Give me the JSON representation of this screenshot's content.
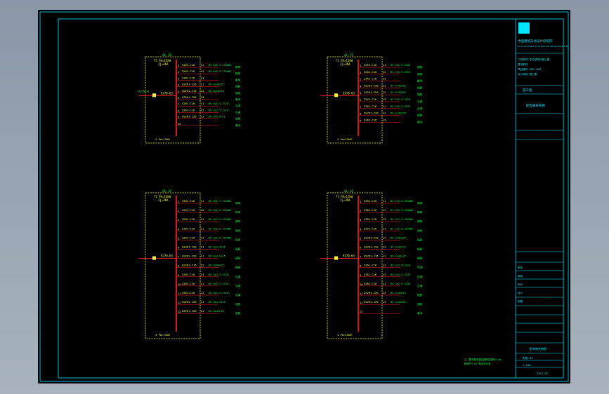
{
  "panels": [
    {
      "id": "AL-1F",
      "incoming": {
        "breaker": "T1 PA=15kW",
        "note": "Ij=36A",
        "cable_tag": "YJV-5x10",
        "device": "E270-63"
      },
      "bottom_note": "4 Pa=15kW",
      "rows": [
        {
          "n": "1",
          "breaker": "S261-C16",
          "phase": "L1",
          "cable": "BV-3x2.5-SC20WC",
          "load": "照明"
        },
        {
          "n": "2",
          "breaker": "S261-C16",
          "phase": "L2",
          "cable": "BV-3x2.5-SC20WC",
          "load": "照明"
        },
        {
          "n": "3",
          "breaker": "S261-C16",
          "phase": "L3",
          "cable": "",
          "load": "备用"
        },
        {
          "n": "4",
          "breaker": "GS261-C20",
          "phase": "L1",
          "cable": "BV-3x4SC25",
          "load": "插座"
        },
        {
          "n": "5",
          "breaker": "GS261-C16",
          "phase": "L2",
          "cable": "BV-3x4SC25",
          "load": "插座"
        },
        {
          "n": "6",
          "breaker": "GS261-C20",
          "phase": "L3",
          "cable": "",
          "load": "备用"
        },
        {
          "n": "7",
          "breaker": "S261-C16",
          "phase": "L1",
          "cable": "BV-3x2.5-SC20",
          "load": "空调"
        },
        {
          "n": "8",
          "breaker": "S261-C16",
          "phase": "L2",
          "cable": "BV-3x2.5-SC20",
          "load": "空调"
        },
        {
          "n": "9",
          "breaker": "GS261-C20",
          "phase": "L3",
          "cable": "BV-3x4-SC25",
          "load": "插座"
        },
        {
          "n": "10",
          "breaker": "",
          "phase": "",
          "cable": "",
          "load": "备用"
        }
      ]
    },
    {
      "id": "AL-2F",
      "incoming": {
        "breaker": "T1 PA=15kW",
        "note": "Ij=36A",
        "cable_tag": "",
        "device": "E270-63"
      },
      "bottom_note": "4 Pa=15kW",
      "rows": [
        {
          "n": "1",
          "breaker": "S261-C16",
          "phase": "L1",
          "cable": "BV-3x2.5-SC20",
          "load": "照明"
        },
        {
          "n": "2",
          "breaker": "S261-C16",
          "phase": "L2",
          "cable": "BV-3x2.5-SC20",
          "load": "照明"
        },
        {
          "n": "3",
          "breaker": "S261-C16",
          "phase": "L3",
          "cable": "",
          "load": "备用"
        },
        {
          "n": "4",
          "breaker": "GS261-C20",
          "phase": "L1",
          "cable": "BV-3x4SC25",
          "load": "插座"
        },
        {
          "n": "5",
          "breaker": "GS261-C20",
          "phase": "L2",
          "cable": "BV-3x4SC25",
          "load": "插座"
        },
        {
          "n": "6",
          "breaker": "S261-C16",
          "phase": "L3",
          "cable": "BV-3x2.5-SC20",
          "load": "空调"
        },
        {
          "n": "7",
          "breaker": "S261-C16",
          "phase": "L1",
          "cable": "BV-3x2.5-SC20",
          "load": "空调"
        },
        {
          "n": "8",
          "breaker": "GS261-C20",
          "phase": "L2",
          "cable": "BV-3x4SC25",
          "load": "插座"
        },
        {
          "n": "9",
          "breaker": "S261-C16",
          "phase": "L3",
          "cable": "",
          "load": "备用"
        }
      ]
    },
    {
      "id": "AL-3F",
      "incoming": {
        "breaker": "T1 PA=15kW",
        "note": "Ij=36A",
        "cable_tag": "",
        "device": "E270-63"
      },
      "bottom_note": "4 Pa=15kW",
      "rows": [
        {
          "n": "1",
          "breaker": "S261-C16",
          "phase": "L1",
          "cable": "BV-3x2.5-SC20WC",
          "load": "照明"
        },
        {
          "n": "2",
          "breaker": "S261-C16",
          "phase": "L2",
          "cable": "BV-3x2.5-SC20WC",
          "load": "照明"
        },
        {
          "n": "3",
          "breaker": "S261-C16",
          "phase": "L3",
          "cable": "BV-3x2.5-SC20WC",
          "load": "照明"
        },
        {
          "n": "4",
          "breaker": "S261-C16",
          "phase": "L1",
          "cable": "BV-3x2.5-SC20WC",
          "load": "照明"
        },
        {
          "n": "5",
          "breaker": "S261-C16",
          "phase": "L2",
          "cable": "BV-3x2.5-SC20WC",
          "load": "照明"
        },
        {
          "n": "6",
          "breaker": "GS261-C20",
          "phase": "L3",
          "cable": "BV-3x4-SC25",
          "load": "插座"
        },
        {
          "n": "7",
          "breaker": "GS261-C20",
          "phase": "L1",
          "cable": "BV-3x4-SC25",
          "load": "插座"
        },
        {
          "n": "8",
          "breaker": "GS261-C16",
          "phase": "L2",
          "cable": "BV-3x4SC25",
          "load": "插座"
        },
        {
          "n": "9",
          "breaker": "S261-C16",
          "phase": "L3",
          "cable": "BV-3x2.5-SC20",
          "load": "空调"
        },
        {
          "n": "10",
          "breaker": "S261-C16",
          "phase": "L1",
          "cable": "BV-3x2.5-SC20",
          "load": "空调"
        },
        {
          "n": "11",
          "breaker": "S261-C16",
          "phase": "L2",
          "cable": "BV-3x2.5-SC20",
          "load": "空调"
        },
        {
          "n": "12",
          "breaker": "GS261-C20",
          "phase": "L3",
          "cable": "BV-3x4-SC25",
          "load": "插座"
        },
        {
          "n": "13",
          "breaker": "GS261-C20",
          "phase": "L1",
          "cable": "BV-3x4SC25",
          "load": "插座"
        }
      ]
    },
    {
      "id": "AL-4F",
      "incoming": {
        "breaker": "T1 PA=15kW",
        "note": "Ij=36A",
        "cable_tag": "",
        "device": "E270-63"
      },
      "bottom_note": "4 Pa=15kW",
      "rows": [
        {
          "n": "1",
          "breaker": "S261-C16",
          "phase": "L1",
          "cable": "BV-3x2.5-SC20WC",
          "load": "照明"
        },
        {
          "n": "2",
          "breaker": "S261-C16",
          "phase": "L2",
          "cable": "BV-3x2.5-SC20WC",
          "load": "照明"
        },
        {
          "n": "3",
          "breaker": "S261-C16",
          "phase": "L3",
          "cable": "BV-3x2.5-SC20WC",
          "load": "照明"
        },
        {
          "n": "4",
          "breaker": "S261-C16",
          "phase": "L1",
          "cable": "BV-3x2.5-SC20WC",
          "load": "照明"
        },
        {
          "n": "5",
          "breaker": "GS261-C20",
          "phase": "L2",
          "cable": "BV-3x4SC25",
          "load": "插座"
        },
        {
          "n": "6",
          "breaker": "GS261-C20",
          "phase": "L3",
          "cable": "BV-3x4SC25",
          "load": "插座"
        },
        {
          "n": "7",
          "breaker": "GS261-C16",
          "phase": "L1",
          "cable": "BV-3x4SC25",
          "load": "插座"
        },
        {
          "n": "8",
          "breaker": "S261-C16",
          "phase": "L2",
          "cable": "BV-3x2.5-SC20",
          "load": "空调"
        },
        {
          "n": "9",
          "breaker": "S261-C16",
          "phase": "L3",
          "cable": "BV-3x2.5-SC20",
          "load": "空调"
        },
        {
          "n": "10",
          "breaker": "S261-C16",
          "phase": "L1",
          "cable": "BV-3x2.5-SC20",
          "load": "空调"
        },
        {
          "n": "11",
          "breaker": "GS261-C20",
          "phase": "L2",
          "cable": "BV-3x4SC25",
          "load": "插座"
        },
        {
          "n": "12",
          "breaker": "GS261-C20",
          "phase": "L3",
          "cable": "BV-3x4SC25",
          "load": "插座"
        },
        {
          "n": "13",
          "breaker": "",
          "phase": "",
          "cable": "",
          "load": "备用"
        }
      ]
    }
  ],
  "title_block": {
    "company": "中国建筑东北设计研究院",
    "company_en": "China Northeast Architectural Design Institute",
    "project_lines": [
      "工程名称 住宅楼电气施工图",
      "建设单位",
      "项目编号 2011-001",
      "设计阶段 施工图"
    ],
    "drawing_title": "配电箱系统图",
    "stage": "施工图",
    "sheet_rows": [
      "审定",
      "审核",
      "校对",
      "设计",
      "制图"
    ],
    "drawing_no": "电施-03",
    "scale": "1:100",
    "date": "2011.05"
  },
  "notes": [
    "注：配电箱安装高度底边距地1.5m",
    "箱体尺寸以厂家实际为准"
  ],
  "colors": {
    "frame": "#00e5ff",
    "breaker": "#ffff33",
    "cable": "#00ff40",
    "bus": "#ff2020",
    "panel_box": "#ffff33",
    "title": "#00e5ff"
  }
}
